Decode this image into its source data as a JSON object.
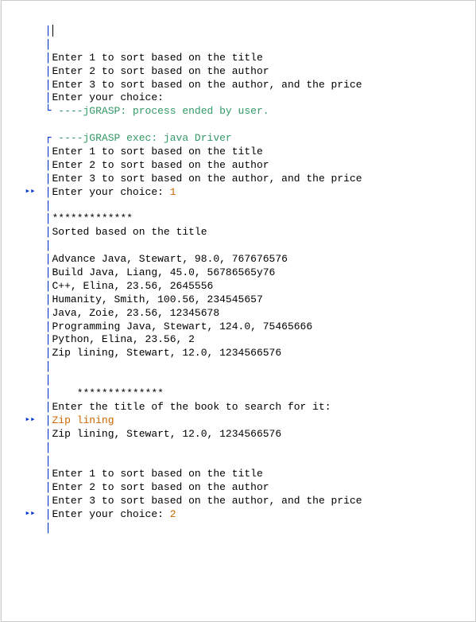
{
  "block1": {
    "lines": [
      "",
      "",
      "Enter 1 to sort based on the title",
      "Enter 2 to sort based on the author",
      "Enter 3 to sort based on the author, and the price",
      "Enter your choice:"
    ],
    "grasp_end": " ----jGRASP: process ended by user."
  },
  "block2": {
    "grasp_exec": " ----jGRASP exec: java Driver",
    "prompt_lines": [
      "Enter 1 to sort based on the title",
      "Enter 2 to sort based on the author",
      "Enter 3 to sort based on the author, and the price"
    ],
    "choice_label": "Enter your choice: ",
    "choice_input": "1",
    "after_choice": [
      "",
      "*************",
      "Sorted based on the title",
      "",
      "Advance Java, Stewart, 98.0, 767676576",
      "Build Java, Liang, 45.0, 56786565y76",
      "C++, Elina, 23.56, 2645556",
      "Humanity, Smith, 100.56, 234545657",
      "Java, Zoie, 23.56, 12345678",
      "Programming Java, Stewart, 124.0, 75465666",
      "Python, Elina, 23.56, 2",
      "Zip lining, Stewart, 12.0, 1234566576",
      "",
      "",
      "    **************",
      "Enter the title of the book to search for it:"
    ],
    "search_input": "Zip lining",
    "after_search": [
      "Zip lining, Stewart, 12.0, 1234566576",
      "",
      "",
      "Enter 1 to sort based on the title",
      "Enter 2 to sort based on the author",
      "Enter 3 to sort based on the author, and the price"
    ],
    "choice2_label": "Enter your choice: ",
    "choice2_input": "2",
    "after_choice2": [
      ""
    ]
  }
}
